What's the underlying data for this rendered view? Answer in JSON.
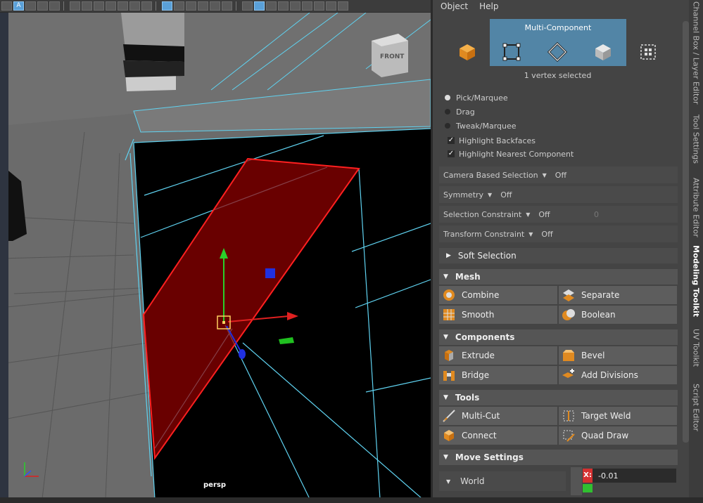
{
  "menu": {
    "object": "Object",
    "help": "Help"
  },
  "multi_component": {
    "title": "Multi-Component",
    "icons": [
      "object-mode-icon",
      "vertex-mode-icon",
      "edge-mode-icon",
      "face-mode-icon",
      "uv-mode-icon"
    ],
    "selection_status": "1 vertex selected"
  },
  "pick_modes": [
    {
      "label": "Pick/Marquee",
      "selected": true
    },
    {
      "label": "Drag",
      "selected": false
    },
    {
      "label": "Tweak/Marquee",
      "selected": false
    }
  ],
  "checkboxes": [
    {
      "label": "Highlight Backfaces",
      "checked": true
    },
    {
      "label": "Highlight Nearest Component",
      "checked": true
    }
  ],
  "dropdowns": {
    "camera_based": {
      "label": "Camera Based Selection",
      "value": "Off"
    },
    "symmetry": {
      "label": "Symmetry",
      "value": "Off"
    },
    "selection_constraint": {
      "label": "Selection Constraint",
      "value": "Off",
      "number": "0"
    },
    "transform_constraint": {
      "label": "Transform Constraint",
      "value": "Off"
    }
  },
  "sections": {
    "soft_selection": "Soft Selection",
    "mesh": "Mesh",
    "components": "Components",
    "tools": "Tools",
    "move_settings": "Move Settings"
  },
  "mesh_tools": {
    "combine": "Combine",
    "separate": "Separate",
    "smooth": "Smooth",
    "boolean": "Boolean"
  },
  "component_tools": {
    "extrude": "Extrude",
    "bevel": "Bevel",
    "bridge": "Bridge",
    "add_divisions": "Add Divisions"
  },
  "tools": {
    "multi_cut": "Multi-Cut",
    "target_weld": "Target Weld",
    "connect": "Connect",
    "quad_draw": "Quad Draw"
  },
  "move_settings": {
    "space": "World",
    "x_label": "X:",
    "x_value": "-0.01"
  },
  "viewport": {
    "camera": "persp",
    "view_cube": "FRONT"
  },
  "side_tabs": [
    "Channel Box / Layer Editor",
    "Tool Settings",
    "Attribute Editor",
    "Modeling Toolkit",
    "UV Toolkit",
    "Script Editor"
  ],
  "toolbar_glyphs": {
    "select": "A"
  },
  "colors": {
    "accent": "#5285a6",
    "selection": "#ff2020",
    "wire": "#5fd2f0"
  }
}
